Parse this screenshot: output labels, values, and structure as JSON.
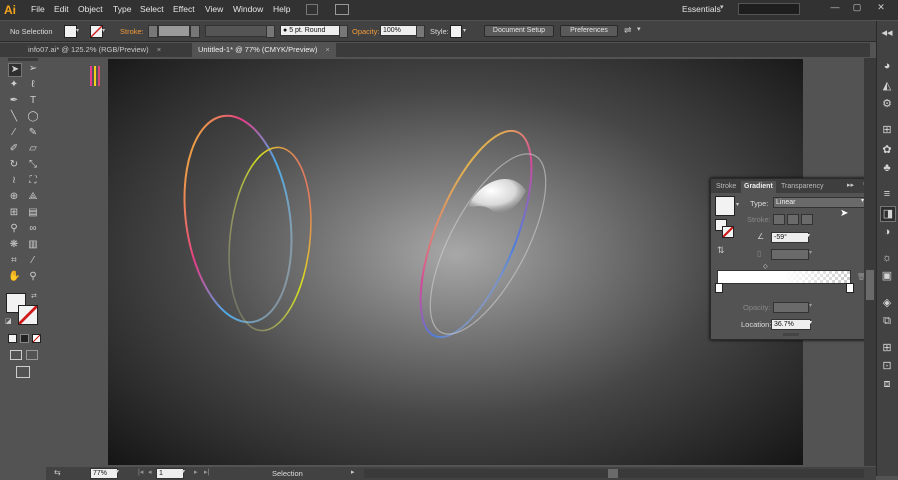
{
  "menubar": {
    "logo": "Ai",
    "items": [
      "File",
      "Edit",
      "Object",
      "Type",
      "Select",
      "Effect",
      "View",
      "Window",
      "Help"
    ],
    "workspace": "Essentials",
    "window_controls": [
      "—",
      "▢",
      "✕"
    ]
  },
  "controlbar": {
    "selection_state": "No Selection",
    "stroke_label": "Stroke:",
    "brush_value": "5 pt. Round",
    "opacity_label": "Opacity:",
    "opacity_value": "100%",
    "style_label": "Style:",
    "document_setup": "Document Setup",
    "preferences": "Preferences"
  },
  "tabs": [
    {
      "label": "info07.ai* @ 125.2% (RGB/Preview)"
    },
    {
      "label": "Untitled-1* @ 77% (CMYK/Preview)"
    }
  ],
  "gradient_panel": {
    "tabs": [
      "Stroke",
      "Gradient",
      "Transparency"
    ],
    "type_label": "Type:",
    "type_value": "Linear",
    "stroke_label": "Stroke:",
    "angle_value": "-59°",
    "opacity_label": "Opacity:",
    "location_label": "Location:",
    "location_value": "36.7%"
  },
  "statusbar": {
    "zoom": "77%",
    "page": "1",
    "mode": "Selection"
  },
  "colors": {
    "accent": "#f29a3a",
    "logo": "#f7a41c",
    "canvas_bg": "#535353"
  },
  "icons": {
    "toolbar": [
      "selection-tool",
      "direct-selection-tool",
      "magic-wand-tool",
      "lasso-tool",
      "pen-tool",
      "type-tool",
      "line-tool",
      "ellipse-tool",
      "paintbrush-tool",
      "pencil-tool",
      "blob-brush-tool",
      "eraser-tool",
      "rotate-tool",
      "scale-tool",
      "width-tool",
      "free-transform-tool",
      "shape-builder-tool",
      "perspective-tool",
      "mesh-tool",
      "gradient-tool",
      "eyedropper-tool",
      "blend-tool",
      "symbol-sprayer-tool",
      "graph-tool",
      "artboard-tool",
      "slice-tool",
      "hand-tool",
      "zoom-tool"
    ]
  }
}
